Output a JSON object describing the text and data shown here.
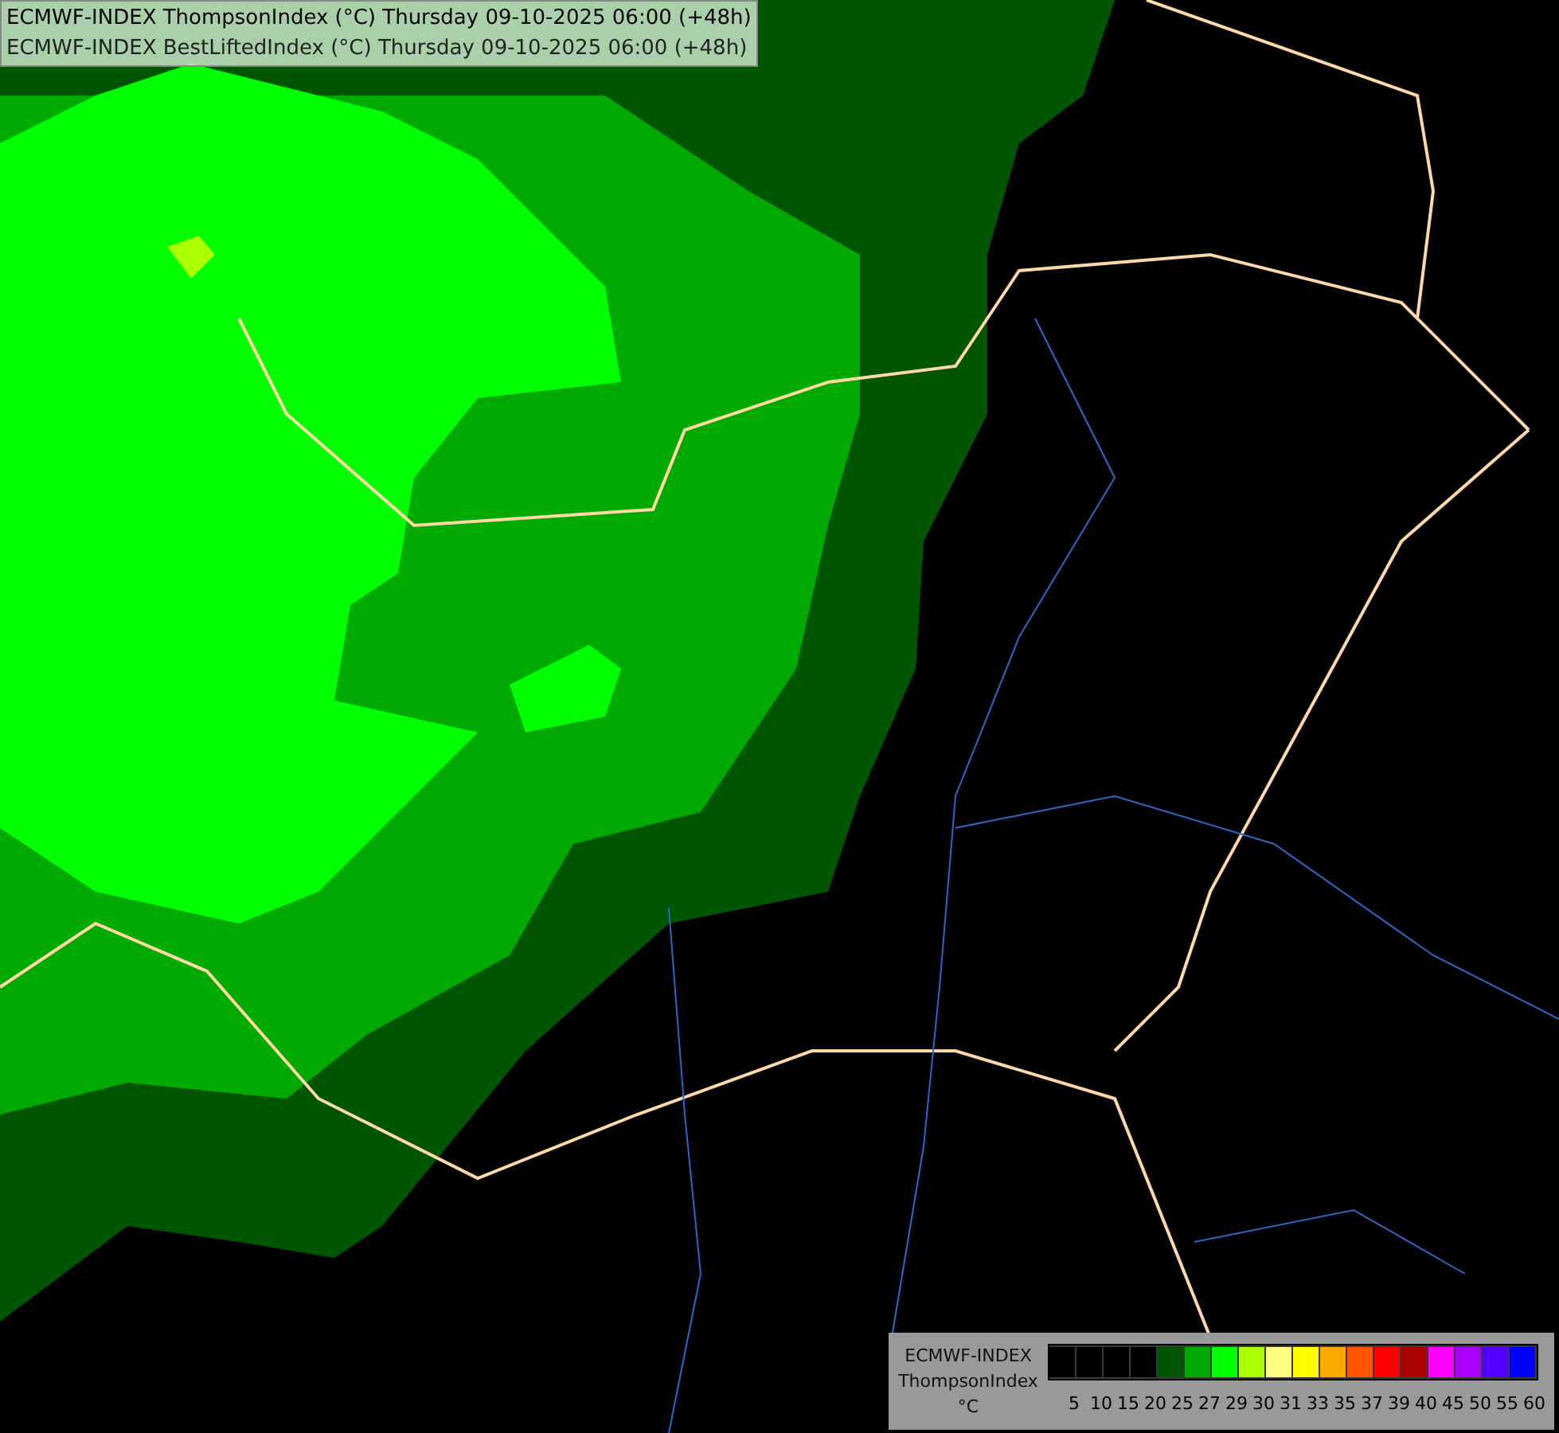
{
  "titles": [
    "ECMWF-INDEX ThompsonIndex (°C) Thursday 09-10-2025 06:00 (+48h)",
    "ECMWF-INDEX BestLiftedIndex (°C) Thursday 09-10-2025 06:00 (+48h)"
  ],
  "legend": {
    "labels": [
      "ECMWF-INDEX",
      "ThompsonIndex",
      "°C"
    ],
    "swatches": [
      {
        "color": "#000000"
      },
      {
        "color": "#000000"
      },
      {
        "color": "#000000"
      },
      {
        "color": "#000000"
      },
      {
        "color": "#005500"
      },
      {
        "color": "#00aa00"
      },
      {
        "color": "#00ff00"
      },
      {
        "color": "#aaff00"
      },
      {
        "color": "#ffff80"
      },
      {
        "color": "#ffff00"
      },
      {
        "color": "#ffaa00"
      },
      {
        "color": "#ff5500"
      },
      {
        "color": "#ff0000"
      },
      {
        "color": "#aa0000"
      },
      {
        "color": "#ff00ff"
      },
      {
        "color": "#aa00ff"
      },
      {
        "color": "#5500ff"
      },
      {
        "color": "#0000ff"
      }
    ],
    "ticks": [
      "5",
      "10",
      "15",
      "20",
      "25",
      "27",
      "29",
      "30",
      "31",
      "33",
      "35",
      "37",
      "39",
      "40",
      "45",
      "50",
      "55",
      "60"
    ]
  }
}
